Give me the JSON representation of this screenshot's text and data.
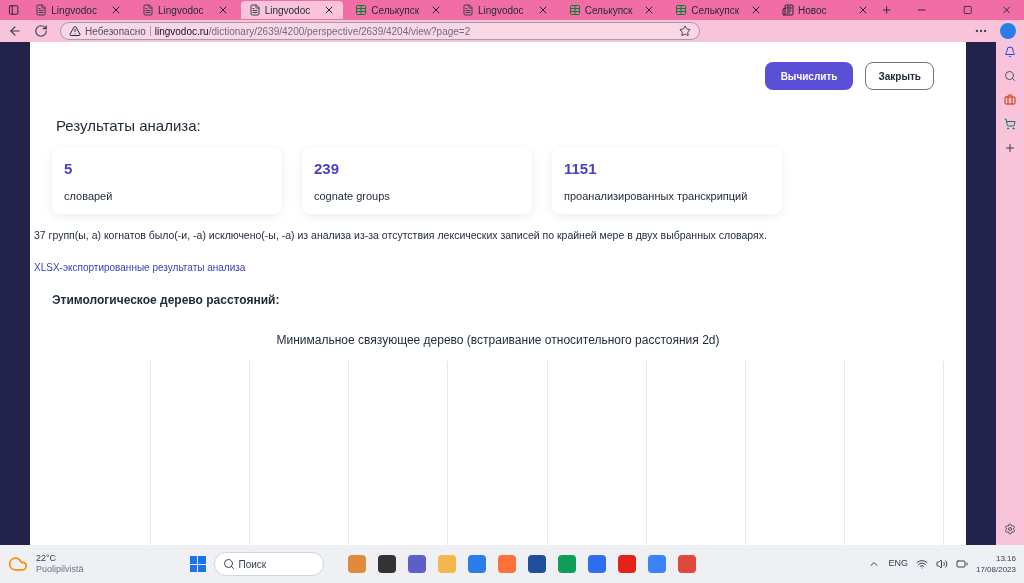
{
  "browser": {
    "tabs": [
      {
        "title": "Lingvodoc",
        "kind": "doc",
        "selected": false
      },
      {
        "title": "Lingvodoc",
        "kind": "doc",
        "selected": false
      },
      {
        "title": "Lingvodoc",
        "kind": "doc",
        "selected": true
      },
      {
        "title": "Селькупск",
        "kind": "sheet",
        "selected": false
      },
      {
        "title": "Lingvodoc",
        "kind": "doc",
        "selected": false
      },
      {
        "title": "Селькупск",
        "kind": "sheet",
        "selected": false
      },
      {
        "title": "Селькупск",
        "kind": "sheet",
        "selected": false
      },
      {
        "title": "Новос",
        "kind": "news",
        "selected": false
      }
    ],
    "security": "Небезопасно",
    "url_host": "lingvodoc.ru",
    "url_path": "/dictionary/2639/4200/perspective/2639/4204/view?page=2"
  },
  "modal": {
    "buttons": [
      {
        "label": "Вычислить",
        "kind": "primary"
      },
      {
        "label": "Закрыть",
        "kind": "outline"
      }
    ],
    "heading": "Результаты анализа:",
    "stats": [
      {
        "value": "5",
        "label": "словарей"
      },
      {
        "value": "239",
        "label": "cognate groups"
      },
      {
        "value": "1151",
        "label": "проанализированных транскрипций"
      }
    ],
    "note": "37 групп(ы, а) когнатов было(-и, -а) исключено(-ы, -а) из анализа из-за отсутствия лексических записей по крайней мере в двух выбранных словарях.",
    "export_link": "XLSX-экспортированные результаты анализа",
    "tree_heading": "Этимологическое дерево расстояний:",
    "chart_title": "Минимальное связующее дерево (встраивание относительного расстояния 2d)"
  },
  "taskbar": {
    "temperature": "22°C",
    "weather": "Puolipilvistä",
    "search": "Поиск",
    "language": "ENG",
    "time": "13.16",
    "date": "17/08/2023"
  }
}
